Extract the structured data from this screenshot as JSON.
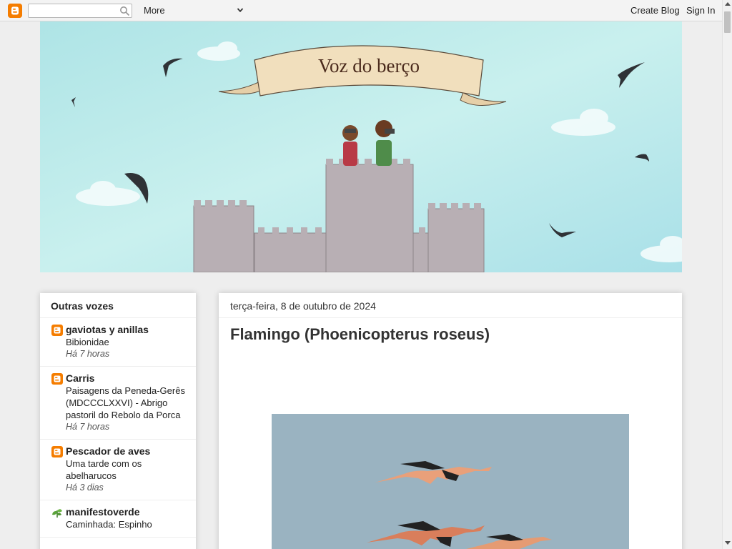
{
  "navbar": {
    "search_placeholder": "",
    "more_label": "More",
    "create_blog_label": "Create Blog",
    "sign_in_label": "Sign In"
  },
  "header": {
    "banner_title": "Voz do berço"
  },
  "sidebar": {
    "title": "Outras vozes",
    "items": [
      {
        "name": "gaviotas y anillas",
        "post": "Bibionidae",
        "time": "Há 7 horas",
        "icon": "blogger-icon"
      },
      {
        "name": "Carris",
        "post": "Paisagens da Peneda-Gerês (MDCCCLXXVI) - Abrigo pastoril do Rebolo da Porca",
        "time": "Há 7 horas",
        "icon": "blogger-icon"
      },
      {
        "name": "Pescador de aves",
        "post": "Uma tarde com os abelharucos",
        "time": "Há 3 dias",
        "icon": "blogger-icon"
      },
      {
        "name": "manifestoverde",
        "post": "Caminhada: Espinho",
        "time": "",
        "icon": "leaf-icon"
      }
    ]
  },
  "main": {
    "date": "terça-feira, 8 de outubro de 2024",
    "post_title": "Flamingo (Phoenicopterus roseus)"
  },
  "colors": {
    "blogger_orange": "#f57d00",
    "page_bg": "#eeeeee",
    "sky": "#bfe9ec"
  }
}
